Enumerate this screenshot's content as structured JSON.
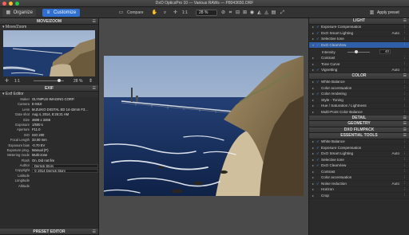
{
  "window": {
    "title": "DxO OpticsPro 10 — Various RAWs — P8043650.ORF"
  },
  "toolbar": {
    "organize_label": "Organize",
    "customize_label": "Customize",
    "compare_label": "Compare",
    "zoom_ratio": "1:1",
    "zoom_percent": "28 %",
    "apply_preset_label": "Apply preset"
  },
  "left_panel": {
    "move_zoom": {
      "title": "MOVE/ZOOM",
      "subtitle": "Move/Zoom",
      "ratio": "1:1",
      "percent": "28 %"
    },
    "exif": {
      "title": "EXIF",
      "subtitle": "Exif Editor",
      "rows": [
        {
          "label": "Maker",
          "value": "OLYMPUS IMAGING CORP."
        },
        {
          "label": "Camera",
          "value": "E-M10"
        },
        {
          "label": "Lens",
          "value": "M.ZUIKO DIGITAL ED 14-42mm F3..."
        },
        {
          "label": "Date shot",
          "value": "Aug 4, 2014, 8:25:21 AM"
        },
        {
          "label": "Size",
          "value": "4608 x 3456"
        },
        {
          "label": "Exposure",
          "value": "1/500 s"
        },
        {
          "label": "Aperture",
          "value": "F11.0"
        },
        {
          "label": "ISO",
          "value": "ISO 200"
        },
        {
          "label": "Focal Length",
          "value": "33.00 mm"
        },
        {
          "label": "Exposure bias",
          "value": "-0.70 EV"
        },
        {
          "label": "Exposure prog.",
          "value": "Manual (P)"
        },
        {
          "label": "Metering mode",
          "value": "Multi-zone"
        },
        {
          "label": "Flash",
          "value": "On, Did not fire"
        },
        {
          "label": "Author",
          "value": "Derrick Story",
          "boxed": true
        },
        {
          "label": "Copyright",
          "value": "© 2014 Derrick Story",
          "boxed": true
        },
        {
          "label": "Latitude",
          "value": ""
        },
        {
          "label": "Longitude",
          "value": ""
        },
        {
          "label": "Altitude",
          "value": ""
        }
      ]
    },
    "preset_editor": {
      "title": "PRESET EDITOR"
    }
  },
  "right_panel": {
    "light": {
      "title": "LIGHT",
      "items": [
        {
          "label": "Exposure Compensation",
          "value": "",
          "on": true
        },
        {
          "label": "DxO Smart Lighting",
          "value": "Auto",
          "on": true
        },
        {
          "label": "Selective tone",
          "value": "",
          "on": true
        },
        {
          "label": "DxO ClearView",
          "value": "",
          "on": true,
          "selected": true
        }
      ],
      "intensity": {
        "label": "Intensity",
        "value": "40",
        "fraction": 0.4
      },
      "items2": [
        {
          "label": "Contrast",
          "value": "",
          "on": false
        },
        {
          "label": "Tone Curve",
          "value": "",
          "on": false
        },
        {
          "label": "Vignetting",
          "value": "Auto",
          "on": true
        }
      ]
    },
    "color": {
      "title": "COLOR",
      "items": [
        {
          "label": "White Balance",
          "value": "",
          "on": true
        },
        {
          "label": "Color accentuation",
          "value": "",
          "on": false
        },
        {
          "label": "Color rendering",
          "value": "",
          "on": true
        },
        {
          "label": "Style - Toning",
          "value": "",
          "on": false
        },
        {
          "label": "Hue / Saturation / Lightness",
          "value": "",
          "on": false
        },
        {
          "label": "Multi-Point Color Balance",
          "value": "",
          "on": false
        }
      ]
    },
    "detail": {
      "title": "DETAIL"
    },
    "geometry": {
      "title": "GEOMETRY"
    },
    "filmpack": {
      "title": "DXO FILMPACK"
    },
    "essential": {
      "title": "ESSENTIAL TOOLS",
      "items": [
        {
          "label": "White Balance",
          "value": "",
          "on": true
        },
        {
          "label": "Exposure Compensation",
          "value": "",
          "on": true
        },
        {
          "label": "DxO Smart Lighting",
          "value": "Auto",
          "on": true
        },
        {
          "label": "Selective tone",
          "value": "",
          "on": true
        },
        {
          "label": "DxO ClearView",
          "value": "",
          "on": true
        },
        {
          "label": "Contrast",
          "value": "",
          "on": false
        },
        {
          "label": "Color accentuation",
          "value": "",
          "on": false
        },
        {
          "label": "Noise reduction",
          "value": "Auto",
          "on": true
        },
        {
          "label": "Horizon",
          "value": "",
          "on": false
        },
        {
          "label": "Crop",
          "value": "",
          "on": false
        }
      ]
    }
  },
  "colors": {
    "accent": "#2f6fd0",
    "selected_row": "#2f5fa8",
    "enabled_check": "#4c9bff"
  }
}
